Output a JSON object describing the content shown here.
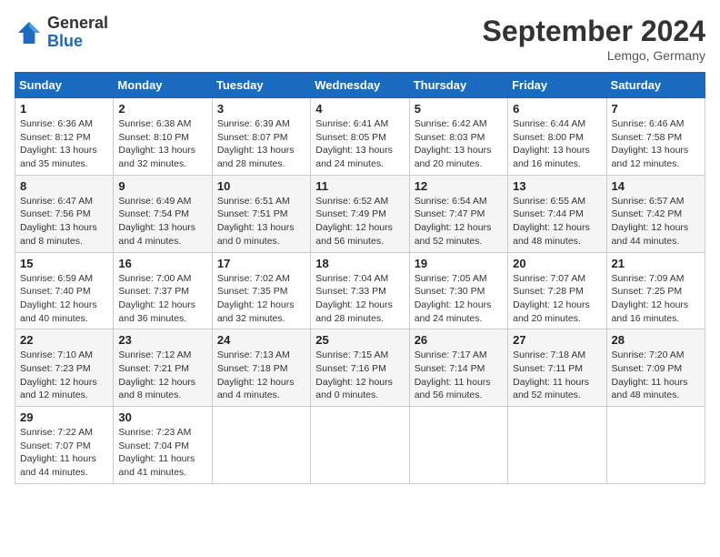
{
  "header": {
    "logo_line1": "General",
    "logo_line2": "Blue",
    "month": "September 2024",
    "location": "Lemgo, Germany"
  },
  "days_of_week": [
    "Sunday",
    "Monday",
    "Tuesday",
    "Wednesday",
    "Thursday",
    "Friday",
    "Saturday"
  ],
  "weeks": [
    [
      {
        "num": "1",
        "detail": "Sunrise: 6:36 AM\nSunset: 8:12 PM\nDaylight: 13 hours\nand 35 minutes."
      },
      {
        "num": "2",
        "detail": "Sunrise: 6:38 AM\nSunset: 8:10 PM\nDaylight: 13 hours\nand 32 minutes."
      },
      {
        "num": "3",
        "detail": "Sunrise: 6:39 AM\nSunset: 8:07 PM\nDaylight: 13 hours\nand 28 minutes."
      },
      {
        "num": "4",
        "detail": "Sunrise: 6:41 AM\nSunset: 8:05 PM\nDaylight: 13 hours\nand 24 minutes."
      },
      {
        "num": "5",
        "detail": "Sunrise: 6:42 AM\nSunset: 8:03 PM\nDaylight: 13 hours\nand 20 minutes."
      },
      {
        "num": "6",
        "detail": "Sunrise: 6:44 AM\nSunset: 8:00 PM\nDaylight: 13 hours\nand 16 minutes."
      },
      {
        "num": "7",
        "detail": "Sunrise: 6:46 AM\nSunset: 7:58 PM\nDaylight: 13 hours\nand 12 minutes."
      }
    ],
    [
      {
        "num": "8",
        "detail": "Sunrise: 6:47 AM\nSunset: 7:56 PM\nDaylight: 13 hours\nand 8 minutes."
      },
      {
        "num": "9",
        "detail": "Sunrise: 6:49 AM\nSunset: 7:54 PM\nDaylight: 13 hours\nand 4 minutes."
      },
      {
        "num": "10",
        "detail": "Sunrise: 6:51 AM\nSunset: 7:51 PM\nDaylight: 13 hours\nand 0 minutes."
      },
      {
        "num": "11",
        "detail": "Sunrise: 6:52 AM\nSunset: 7:49 PM\nDaylight: 12 hours\nand 56 minutes."
      },
      {
        "num": "12",
        "detail": "Sunrise: 6:54 AM\nSunset: 7:47 PM\nDaylight: 12 hours\nand 52 minutes."
      },
      {
        "num": "13",
        "detail": "Sunrise: 6:55 AM\nSunset: 7:44 PM\nDaylight: 12 hours\nand 48 minutes."
      },
      {
        "num": "14",
        "detail": "Sunrise: 6:57 AM\nSunset: 7:42 PM\nDaylight: 12 hours\nand 44 minutes."
      }
    ],
    [
      {
        "num": "15",
        "detail": "Sunrise: 6:59 AM\nSunset: 7:40 PM\nDaylight: 12 hours\nand 40 minutes."
      },
      {
        "num": "16",
        "detail": "Sunrise: 7:00 AM\nSunset: 7:37 PM\nDaylight: 12 hours\nand 36 minutes."
      },
      {
        "num": "17",
        "detail": "Sunrise: 7:02 AM\nSunset: 7:35 PM\nDaylight: 12 hours\nand 32 minutes."
      },
      {
        "num": "18",
        "detail": "Sunrise: 7:04 AM\nSunset: 7:33 PM\nDaylight: 12 hours\nand 28 minutes."
      },
      {
        "num": "19",
        "detail": "Sunrise: 7:05 AM\nSunset: 7:30 PM\nDaylight: 12 hours\nand 24 minutes."
      },
      {
        "num": "20",
        "detail": "Sunrise: 7:07 AM\nSunset: 7:28 PM\nDaylight: 12 hours\nand 20 minutes."
      },
      {
        "num": "21",
        "detail": "Sunrise: 7:09 AM\nSunset: 7:25 PM\nDaylight: 12 hours\nand 16 minutes."
      }
    ],
    [
      {
        "num": "22",
        "detail": "Sunrise: 7:10 AM\nSunset: 7:23 PM\nDaylight: 12 hours\nand 12 minutes."
      },
      {
        "num": "23",
        "detail": "Sunrise: 7:12 AM\nSunset: 7:21 PM\nDaylight: 12 hours\nand 8 minutes."
      },
      {
        "num": "24",
        "detail": "Sunrise: 7:13 AM\nSunset: 7:18 PM\nDaylight: 12 hours\nand 4 minutes."
      },
      {
        "num": "25",
        "detail": "Sunrise: 7:15 AM\nSunset: 7:16 PM\nDaylight: 12 hours\nand 0 minutes."
      },
      {
        "num": "26",
        "detail": "Sunrise: 7:17 AM\nSunset: 7:14 PM\nDaylight: 11 hours\nand 56 minutes."
      },
      {
        "num": "27",
        "detail": "Sunrise: 7:18 AM\nSunset: 7:11 PM\nDaylight: 11 hours\nand 52 minutes."
      },
      {
        "num": "28",
        "detail": "Sunrise: 7:20 AM\nSunset: 7:09 PM\nDaylight: 11 hours\nand 48 minutes."
      }
    ],
    [
      {
        "num": "29",
        "detail": "Sunrise: 7:22 AM\nSunset: 7:07 PM\nDaylight: 11 hours\nand 44 minutes."
      },
      {
        "num": "30",
        "detail": "Sunrise: 7:23 AM\nSunset: 7:04 PM\nDaylight: 11 hours\nand 41 minutes."
      },
      {
        "num": "",
        "detail": ""
      },
      {
        "num": "",
        "detail": ""
      },
      {
        "num": "",
        "detail": ""
      },
      {
        "num": "",
        "detail": ""
      },
      {
        "num": "",
        "detail": ""
      }
    ]
  ]
}
